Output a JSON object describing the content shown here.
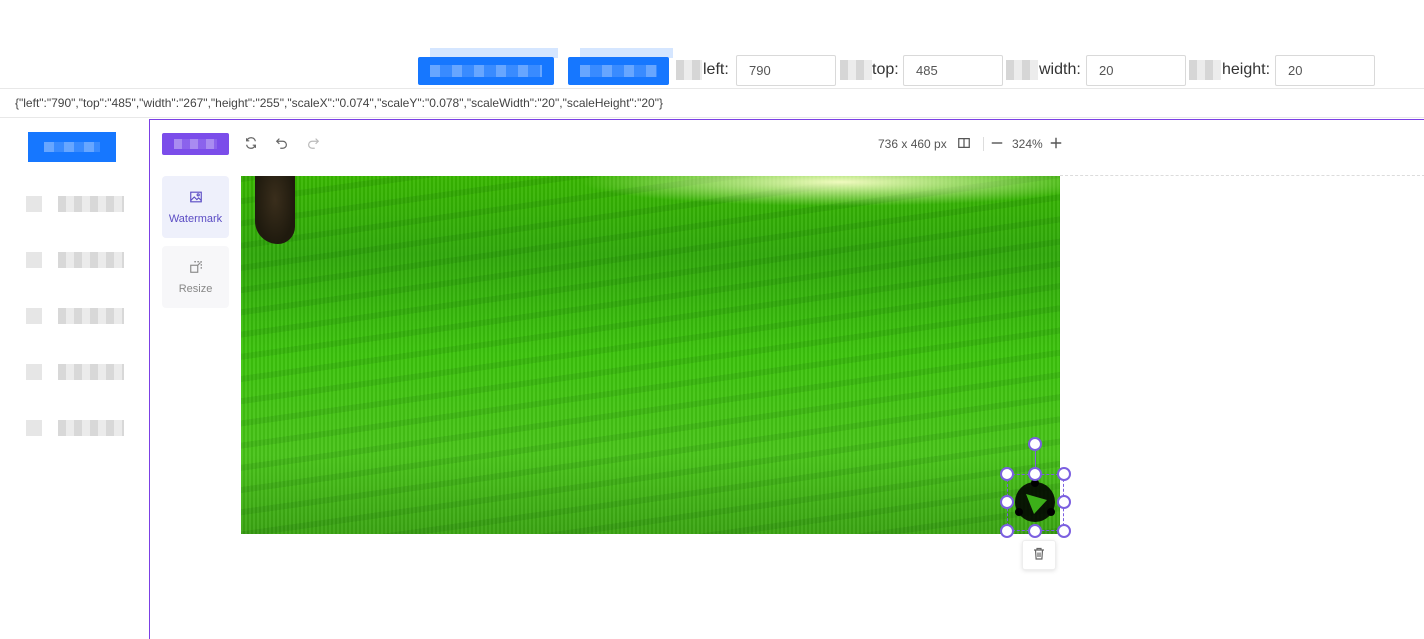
{
  "toolbar": {
    "fields": [
      {
        "label": "left:",
        "value": "790"
      },
      {
        "label": "top:",
        "value": "485"
      },
      {
        "label": "width:",
        "value": "20"
      },
      {
        "label": "height:",
        "value": "20"
      }
    ]
  },
  "json_output": "{\"left\":\"790\",\"top\":\"485\",\"width\":\"267\",\"height\":\"255\",\"scaleX\":\"0.074\",\"scaleY\":\"0.078\",\"scaleWidth\":\"20\",\"scaleHeight\":\"20\"}",
  "editor": {
    "image_size": "736 x 460 px",
    "zoom": "324%",
    "tabs": [
      {
        "label": "Watermark",
        "icon": "image-icon",
        "active": true
      },
      {
        "label": "Resize",
        "icon": "resize-icon",
        "active": false
      }
    ],
    "tools": [
      "refresh-icon",
      "undo-icon",
      "redo-icon",
      "compare-icon",
      "zoom-out-icon",
      "zoom-in-icon"
    ]
  },
  "colors": {
    "primary_blue": "#1677ff",
    "accent_purple": "#7b4dea",
    "selection": "#7b5fe0"
  }
}
